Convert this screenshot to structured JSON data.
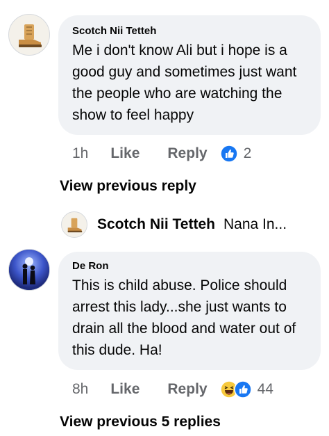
{
  "comments": [
    {
      "author": "Scotch Nii Tetteh",
      "text": "Me i don't know Ali but i hope is a good guy and sometimes just want the people who are watching the show to feel happy",
      "time": "1h",
      "like_label": "Like",
      "reply_label": "Reply",
      "reaction_count": "2",
      "reactions": [
        "like-reaction-icon"
      ],
      "avatar_icon": "boot-avatar-icon"
    },
    {
      "author": "De Ron",
      "text": "This is child abuse. Police should arrest this lady...she just wants to drain all the blood and water out of this dude. Ha!",
      "time": "8h",
      "like_label": "Like",
      "reply_label": "Reply",
      "reaction_count": "44",
      "reactions": [
        "haha-reaction-icon",
        "like-reaction-icon"
      ],
      "avatar_icon": "couple-silhouette-avatar-icon"
    }
  ],
  "view_previous_reply": "View previous reply",
  "reply_preview": {
    "author": "Scotch Nii Tetteh",
    "snippet": "Nana In..."
  },
  "view_previous_replies": "View previous 5 replies",
  "colors": {
    "bubble": "#f0f2f5",
    "meta_text": "#65676b",
    "like_blue": "#1877f2",
    "haha_yellow": "#f7c93d"
  }
}
